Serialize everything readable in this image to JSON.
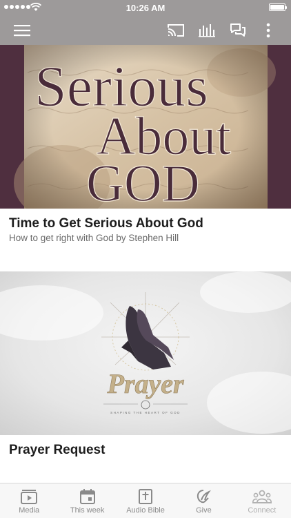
{
  "status_bar": {
    "time": "10:26 AM"
  },
  "toolbar": {
    "icons": [
      "menu-icon",
      "cast-icon",
      "equalizer-icon",
      "chat-icon",
      "more-vert-icon"
    ]
  },
  "cards": [
    {
      "image_text": {
        "line1": "Serious",
        "line2": "About",
        "line3": "GOD"
      },
      "title": "Time to Get Serious About God",
      "subtitle": "How to get right with God by Stephen Hill"
    },
    {
      "image_text": {
        "word": "Prayer",
        "tagline": "SHAPING THE HEART OF GOD"
      },
      "title": "Prayer Request"
    }
  ],
  "tabs": [
    {
      "label": "Media",
      "icon": "play-video-icon"
    },
    {
      "label": "This week",
      "icon": "calendar-icon"
    },
    {
      "label": "Audio Bible",
      "icon": "bible-icon"
    },
    {
      "label": "Give",
      "icon": "give-icon"
    },
    {
      "label": "Connect",
      "icon": "people-icon"
    }
  ],
  "colors": {
    "toolbar": "#9d9a9a",
    "card1_frame": "#4f2f3f",
    "title_text": "#1d1d1d",
    "tab_inactive": "#8a8a8a"
  }
}
